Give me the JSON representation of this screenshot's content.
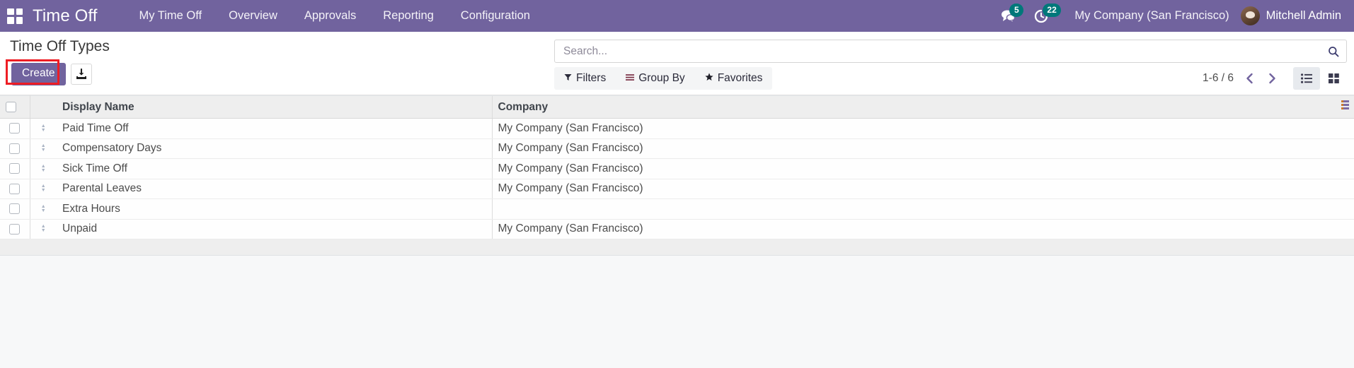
{
  "navbar": {
    "apps_icon": "apps-grid-icon",
    "brand": "Time Off",
    "menu_items": [
      {
        "label": "My Time Off",
        "name": "nav-item-my-time-off"
      },
      {
        "label": "Overview",
        "name": "nav-item-overview"
      },
      {
        "label": "Approvals",
        "name": "nav-item-approvals"
      },
      {
        "label": "Reporting",
        "name": "nav-item-reporting"
      },
      {
        "label": "Configuration",
        "name": "nav-item-configuration"
      }
    ],
    "messages_icon": "messages-icon",
    "messages_badge": "5",
    "activities_icon": "activity-clock-icon",
    "activities_badge": "22",
    "company": "My Company (San Francisco)",
    "user": "Mitchell Admin",
    "accent_color": "#71639e",
    "badge_color": "#00787a"
  },
  "control_panel": {
    "title": "Time Off Types",
    "create_label": "Create",
    "export_icon": "export-download-icon",
    "highlight_color": "#ee1d24",
    "search": {
      "placeholder": "Search...",
      "value": "",
      "icon": "search-icon"
    },
    "filters": [
      {
        "label": "Filters",
        "icon": "funnel-icon",
        "name": "filters-button"
      },
      {
        "label": "Group By",
        "icon": "bars-icon",
        "name": "group-by-button"
      },
      {
        "label": "Favorites",
        "icon": "star-icon",
        "name": "favorites-button"
      }
    ],
    "pager": {
      "count": "1-6 / 6",
      "prev_icon": "chevron-left-icon",
      "next_icon": "chevron-right-icon"
    },
    "views": [
      {
        "name": "list-view-button",
        "icon": "list-view-icon",
        "active": true
      },
      {
        "name": "kanban-view-button",
        "icon": "kanban-view-icon",
        "active": false
      }
    ]
  },
  "list": {
    "columns": [
      {
        "key": "display_name",
        "label": "Display Name"
      },
      {
        "key": "company",
        "label": "Company"
      }
    ],
    "optional_columns_icon": "optional-columns-toggle-icon",
    "rows": [
      {
        "display_name": "Paid Time Off",
        "company": "My Company (San Francisco)"
      },
      {
        "display_name": "Compensatory Days",
        "company": "My Company (San Francisco)"
      },
      {
        "display_name": "Sick Time Off",
        "company": "My Company (San Francisco)"
      },
      {
        "display_name": "Parental Leaves",
        "company": "My Company (San Francisco)"
      },
      {
        "display_name": "Extra Hours",
        "company": ""
      },
      {
        "display_name": "Unpaid",
        "company": "My Company (San Francisco)"
      }
    ]
  }
}
